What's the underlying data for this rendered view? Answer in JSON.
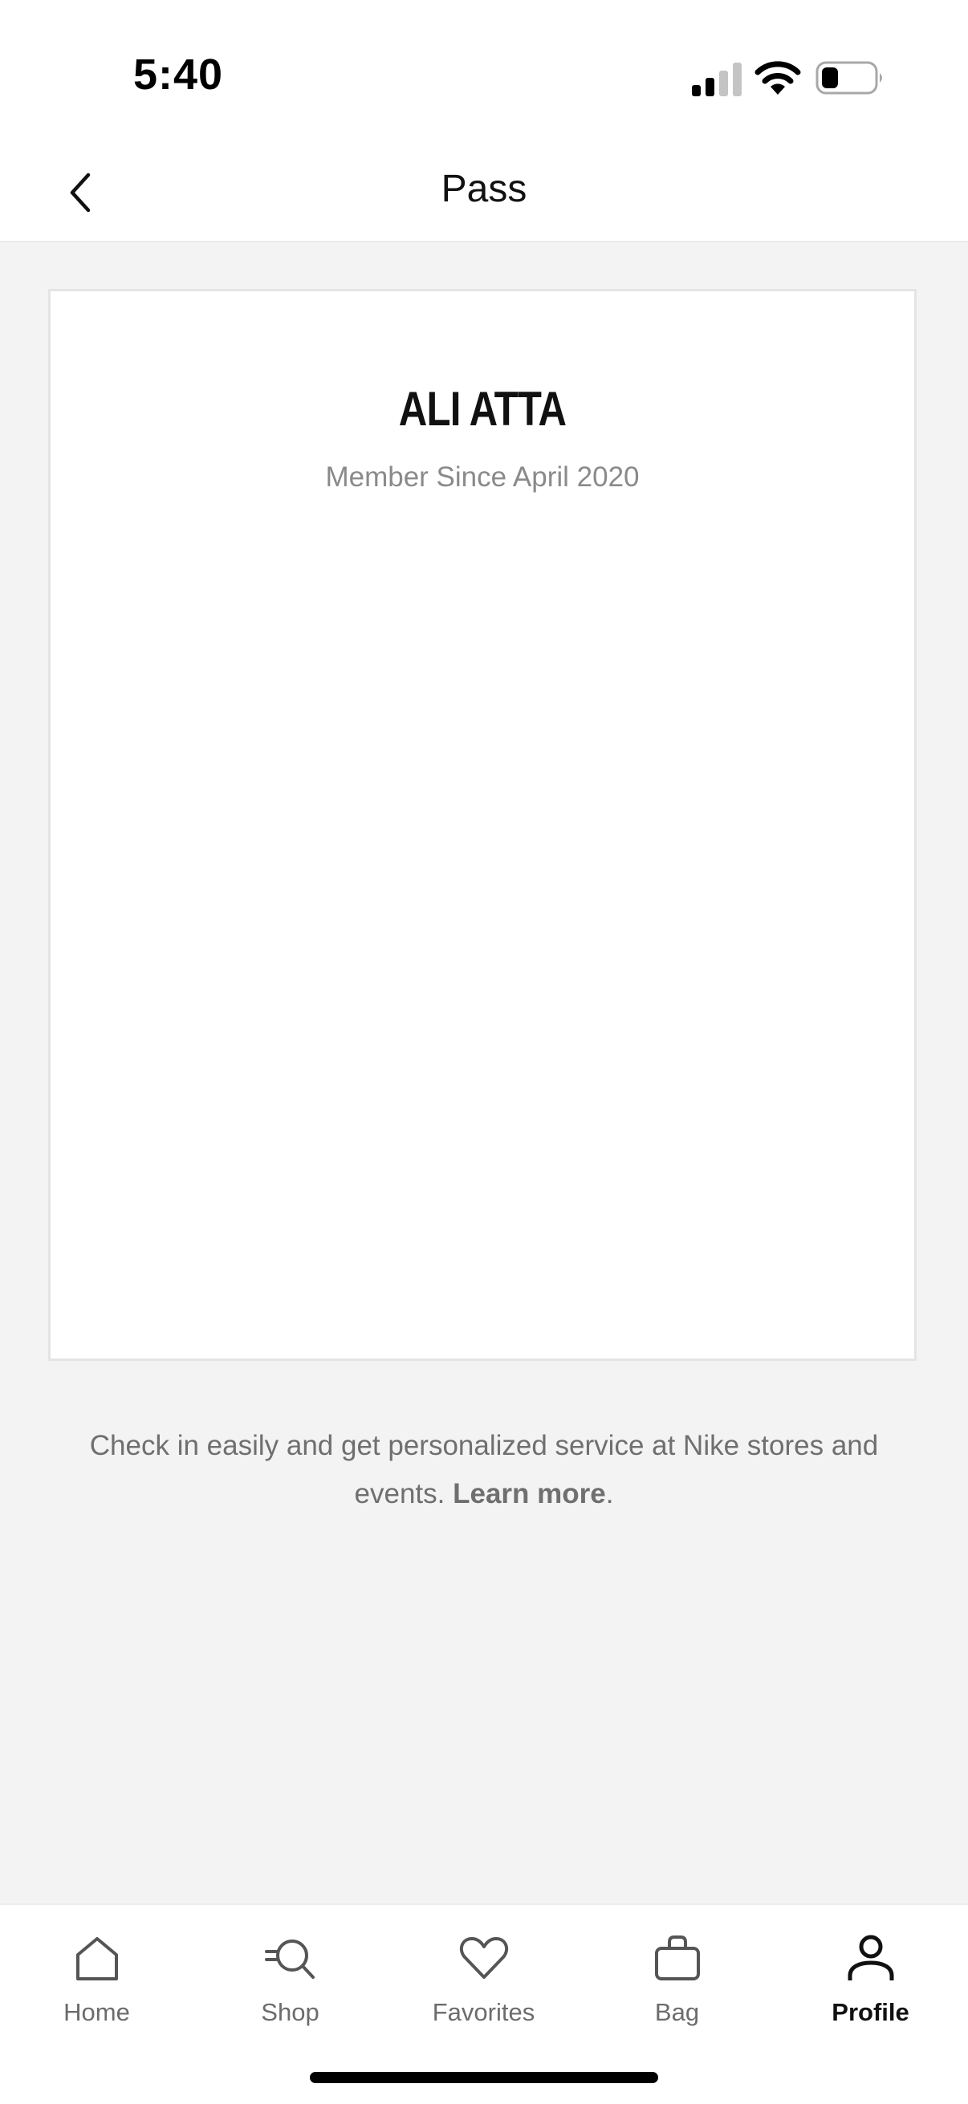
{
  "status_bar": {
    "time": "5:40"
  },
  "header": {
    "title": "Pass"
  },
  "pass": {
    "name": "ALI ATTA",
    "member_since": "Member Since April 2020"
  },
  "info": {
    "text": "Check in easily and get personalized service at Nike stores and events.",
    "link_label": "Learn more",
    "trailing": "."
  },
  "tab_bar": {
    "tabs": [
      {
        "label": "Home",
        "icon": "home-icon"
      },
      {
        "label": "Shop",
        "icon": "shop-search-icon"
      },
      {
        "label": "Favorites",
        "icon": "heart-icon"
      },
      {
        "label": "Bag",
        "icon": "bag-icon"
      },
      {
        "label": "Profile",
        "icon": "person-icon",
        "active": true
      }
    ]
  },
  "colors": {
    "background": "#f3f3f3",
    "card": "#ffffff",
    "text_primary": "#111111",
    "text_secondary": "#8a8a8a"
  }
}
